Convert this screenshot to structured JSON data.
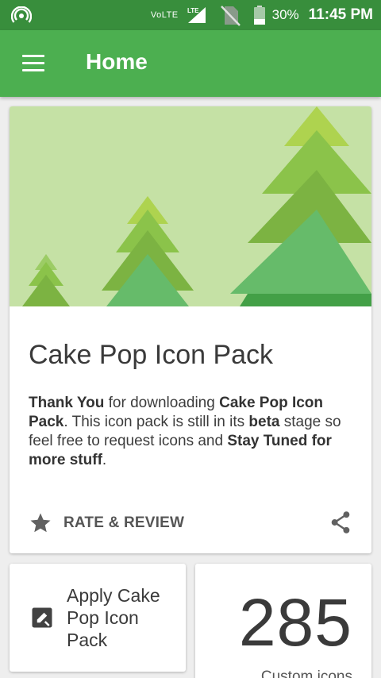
{
  "status_bar": {
    "volte": "VoLTE",
    "lte": "LTE",
    "battery": "30%",
    "time": "11:45 PM"
  },
  "app_bar": {
    "title": "Home"
  },
  "hero": {
    "title": "Cake Pop Icon Pack",
    "desc": {
      "p1": "Thank You",
      "p2": " for downloading ",
      "p3": "Cake Pop Icon Pack",
      "p4": ". This icon pack is still in its ",
      "p5": "beta",
      "p6": " stage so feel free to request icons and ",
      "p7": "Stay Tuned for more stuff",
      "p8": "."
    },
    "rate_label": "RATE & REVIEW"
  },
  "apply": {
    "label": "Apply Cake Pop Icon Pack"
  },
  "stats": {
    "count": "285",
    "label": "Custom icons"
  },
  "colors": {
    "status_bar": "#388e3c",
    "app_bar": "#4caf50",
    "accent": "#4caf50"
  },
  "icons": {
    "hotspot": "hotspot-icon",
    "signal": "signal-icon",
    "no_sim": "no-sim-icon",
    "battery": "battery-icon",
    "menu": "menu-icon",
    "star": "star-icon",
    "share": "share-icon",
    "apply": "apply-icon"
  }
}
